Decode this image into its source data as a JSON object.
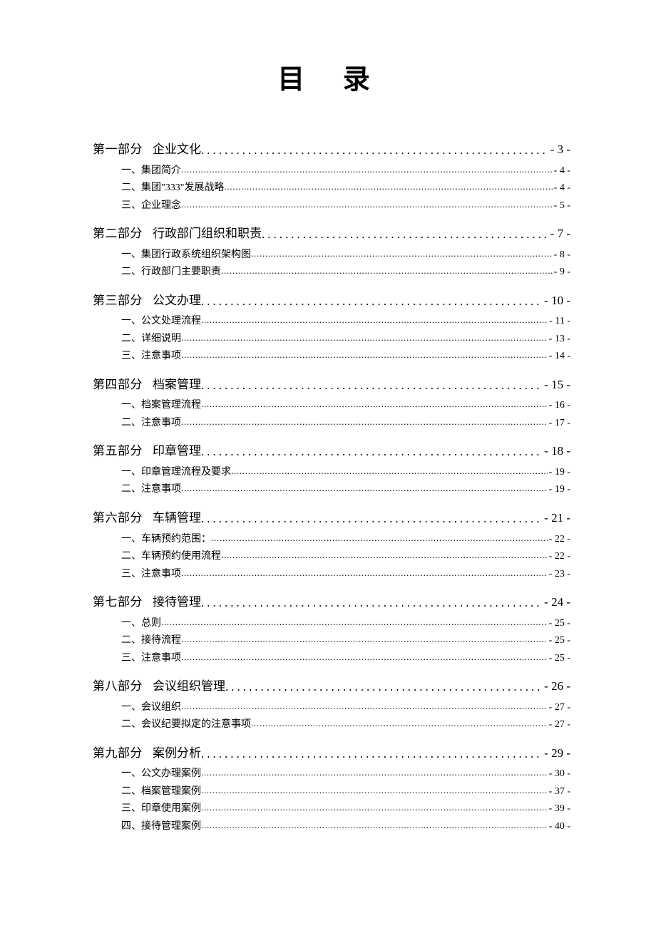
{
  "title": "目  录",
  "sections": [
    {
      "part": "第一部分",
      "heading": "企业文化",
      "page": "- 3 -",
      "items": [
        {
          "label": "一、集团简介",
          "page": "- 4 -"
        },
        {
          "label": "二、集团\"333\"发展战略",
          "page": "- 4 -"
        },
        {
          "label": "三、企业理念",
          "page": "- 5 -"
        }
      ]
    },
    {
      "part": "第二部分",
      "heading": "行政部门组织和职责",
      "page": "- 7 -",
      "items": [
        {
          "label": "一、集团行政系统组织架构图",
          "page": "- 8 -"
        },
        {
          "label": "二、行政部门主要职责",
          "page": "- 9 -"
        }
      ]
    },
    {
      "part": "第三部分",
      "heading": "公文办理",
      "page": "- 10 -",
      "items": [
        {
          "label": "一、公文处理流程",
          "page": "- 11 -"
        },
        {
          "label": "二、详细说明",
          "page": "- 13 -"
        },
        {
          "label": "三、注意事项",
          "page": "- 14 -"
        }
      ]
    },
    {
      "part": "第四部分",
      "heading": "档案管理",
      "page": "- 15 -",
      "items": [
        {
          "label": "一、档案管理流程",
          "page": "- 16 -"
        },
        {
          "label": "二、注意事项",
          "page": "- 17 -"
        }
      ]
    },
    {
      "part": "第五部分",
      "heading": "印章管理",
      "page": "- 18 -",
      "items": [
        {
          "label": "一、印章管理流程及要求",
          "page": "- 19 -"
        },
        {
          "label": "二、注意事项",
          "page": "- 19 -"
        }
      ]
    },
    {
      "part": "第六部分",
      "heading": "车辆管理",
      "page": "- 21 -",
      "items": [
        {
          "label": "一、车辆预约范围：",
          "page": "- 22 -"
        },
        {
          "label": "二、车辆预约使用流程",
          "page": "- 22 -"
        },
        {
          "label": "三、注意事项",
          "page": "- 23 -"
        }
      ]
    },
    {
      "part": "第七部分",
      "heading": "接待管理",
      "page": "- 24 -",
      "items": [
        {
          "label": "一、总则",
          "page": "- 25 -"
        },
        {
          "label": "二、接待流程",
          "page": "- 25 -"
        },
        {
          "label": "三、注意事项",
          "page": "- 25 -"
        }
      ]
    },
    {
      "part": "第八部分",
      "heading": "会议组织管理",
      "page": "- 26 -",
      "items": [
        {
          "label": "一、会议组织",
          "page": "- 27 -"
        },
        {
          "label": "二、会议纪要拟定的注意事项",
          "page": "- 27 -"
        }
      ]
    },
    {
      "part": "第九部分",
      "heading": "案例分析",
      "page": "- 29 -",
      "items": [
        {
          "label": "一、公文办理案例",
          "page": "- 30 -"
        },
        {
          "label": "二、档案管理案例",
          "page": "- 37 -"
        },
        {
          "label": "三、印章使用案例",
          "page": "- 39 -"
        },
        {
          "label": "四、接待管理案例",
          "page": "- 40 -"
        }
      ]
    }
  ]
}
